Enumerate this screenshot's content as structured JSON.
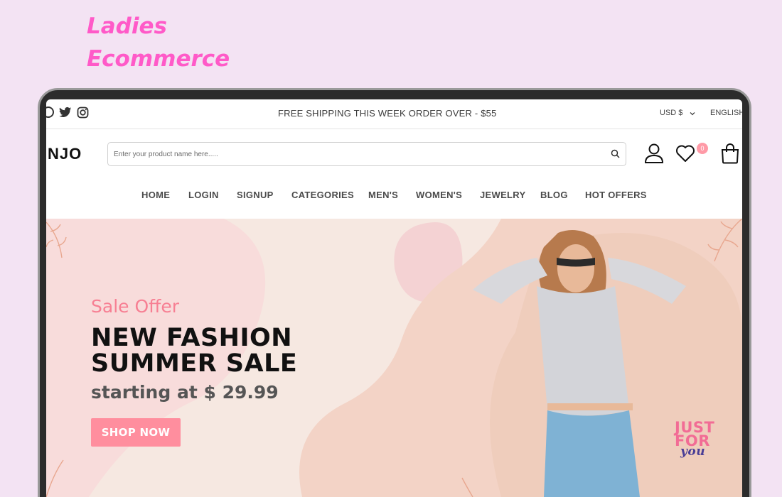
{
  "page": {
    "heading_line1": "Ladies",
    "heading_line2": "Ecommerce",
    "heading_color": "#ff5ac8",
    "background_color": "#f3e3f3"
  },
  "topbar": {
    "social_icons": [
      "pinterest-icon",
      "twitter-icon",
      "instagram-icon"
    ],
    "shipping_text": "FREE SHIPPING THIS WEEK ORDER OVER - $55",
    "currency": "USD $",
    "language": "ENGLISH"
  },
  "header": {
    "logo": "NJO",
    "search_placeholder": "Enter your product name here.....",
    "wishlist_count": "0",
    "icons": [
      "search-icon",
      "user-icon",
      "heart-icon",
      "shopping-bag-icon"
    ]
  },
  "nav": {
    "items": [
      "HOME",
      "LOGIN",
      "SIGNUP",
      "CATEGORIES",
      "MEN'S",
      "WOMEN'S",
      "JEWELRY",
      "BLOG",
      "HOT OFFERS"
    ]
  },
  "hero": {
    "tagline": "Sale Offer",
    "headline_line1": "NEW FASHION",
    "headline_line2": "SUMMER SALE",
    "price_text": "starting at $ 29.99",
    "cta_label": "SHOP NOW",
    "badge_line1": "JUST",
    "badge_line2": "FOR",
    "badge_line3": "you",
    "accent_color": "#ff8e9e",
    "hero_bg": "#f6e8e1"
  }
}
